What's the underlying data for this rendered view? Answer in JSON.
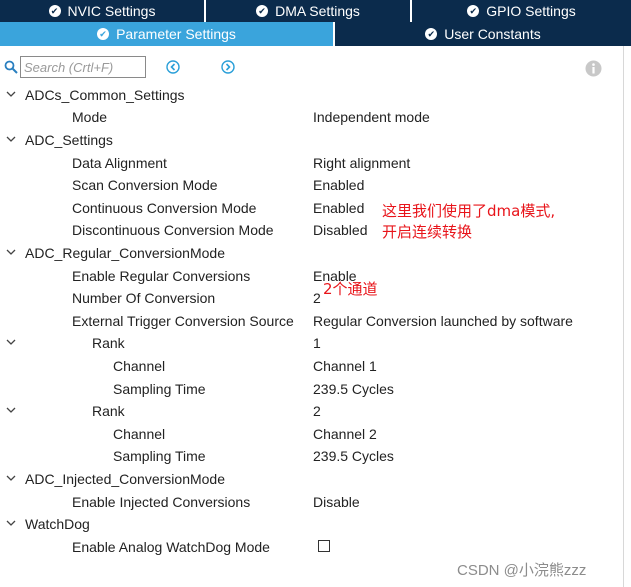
{
  "tabs_row1": [
    {
      "label": "NVIC Settings",
      "active": false
    },
    {
      "label": "DMA Settings",
      "active": false
    },
    {
      "label": "GPIO Settings",
      "active": false
    }
  ],
  "tabs_row2": [
    {
      "label": "Parameter Settings",
      "active": true
    },
    {
      "label": "User Constants",
      "active": false
    }
  ],
  "colors": {
    "tab_dark": "#0b2b4c",
    "tab_active": "#3aa4dc",
    "annotation": "#e8141a"
  },
  "search": {
    "placeholder": "Search (Crtl+F)",
    "value": ""
  },
  "icons": {
    "search": "search-icon",
    "prev": "previous-arrow-icon",
    "next": "next-arrow-icon",
    "info": "info-icon",
    "expand": "chevron-down-icon",
    "tab_gear": "gear-icon"
  },
  "tree": {
    "adcs_common": {
      "label": "ADCs_Common_Settings",
      "mode": {
        "label": "Mode",
        "value": "Independent mode"
      }
    },
    "adc_settings": {
      "label": "ADC_Settings",
      "data_alignment": {
        "label": "Data Alignment",
        "value": "Right alignment"
      },
      "scan_mode": {
        "label": "Scan Conversion Mode",
        "value": "Enabled"
      },
      "continuous_mode": {
        "label": "Continuous Conversion Mode",
        "value": "Enabled"
      },
      "discontinuous_mode": {
        "label": "Discontinuous Conversion Mode",
        "value": "Disabled"
      }
    },
    "regular": {
      "label": "ADC_Regular_ConversionMode",
      "enable_regular": {
        "label": "Enable Regular Conversions",
        "value": "Enable"
      },
      "num_conversion": {
        "label": "Number Of Conversion",
        "value": "2"
      },
      "ext_trigger": {
        "label": "External Trigger Conversion Source",
        "value": "Regular Conversion launched by software"
      },
      "rank1": {
        "label": "Rank",
        "value": "1",
        "channel": {
          "label": "Channel",
          "value": "Channel 1"
        },
        "sampling": {
          "label": "Sampling Time",
          "value": "239.5 Cycles"
        }
      },
      "rank2": {
        "label": "Rank",
        "value": "2",
        "channel": {
          "label": "Channel",
          "value": "Channel 2"
        },
        "sampling": {
          "label": "Sampling Time",
          "value": "239.5 Cycles"
        }
      }
    },
    "injected": {
      "label": "ADC_Injected_ConversionMode",
      "enable_injected": {
        "label": "Enable Injected Conversions",
        "value": "Disable"
      }
    },
    "watchdog": {
      "label": "WatchDog",
      "enable_analog": {
        "label": "Enable Analog WatchDog Mode",
        "checked": false
      }
    }
  },
  "annotations": {
    "dma_note_line1": "这里我们使用了dma模式,",
    "dma_note_line2": "开启连续转换",
    "channels_note": "2个通道"
  },
  "watermark": "CSDN @小浣熊zzz"
}
